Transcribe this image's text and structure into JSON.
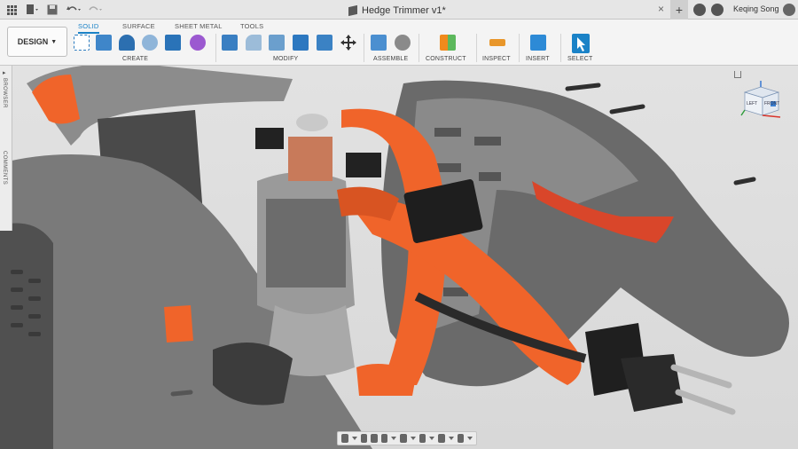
{
  "titlebar": {
    "doc_title": "Hedge Trimmer v1*",
    "close": "×",
    "plus": "+",
    "user": "Keqing Song"
  },
  "ribbon": {
    "workspace": "DESIGN",
    "tabs": [
      "SOLID",
      "SURFACE",
      "SHEET METAL",
      "TOOLS"
    ],
    "groups": [
      "CREATE",
      "MODIFY",
      "ASSEMBLE",
      "CONSTRUCT",
      "INSPECT",
      "INSERT",
      "SELECT"
    ]
  },
  "sidepanel": {
    "browser": "BROWSER",
    "comments": "COMMENTS"
  },
  "viewcube": {
    "left": "LEFT",
    "front": "FRONT",
    "top": "TOP"
  },
  "colors": {
    "accent": "#1a82c7",
    "orange": "#f0642a",
    "plastic": "#5d5d5d"
  }
}
